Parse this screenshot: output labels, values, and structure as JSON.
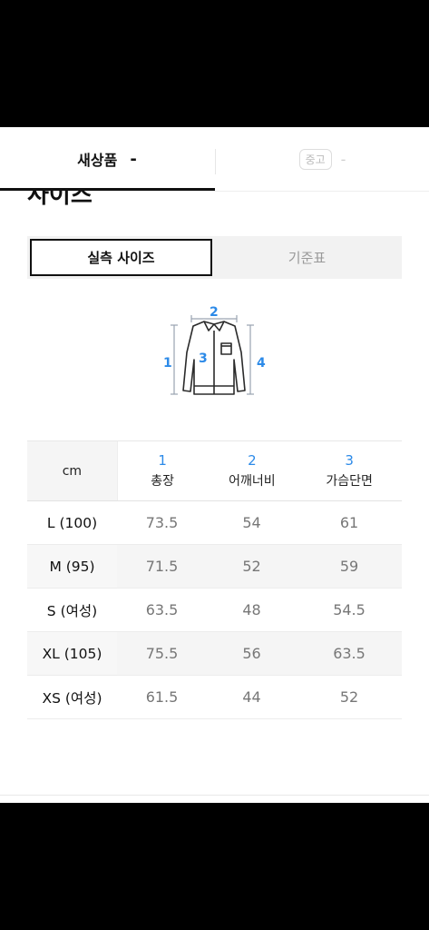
{
  "tabs": {
    "new_label": "새상품",
    "new_price": "-",
    "used_badge": "중고",
    "used_price": "-"
  },
  "section": {
    "title": "사이즈"
  },
  "segmented": {
    "active": "실측 사이즈",
    "inactive": "기준표"
  },
  "diagram": {
    "labels": [
      "1",
      "2",
      "3",
      "4"
    ],
    "accent_color": "#2c8ae8"
  },
  "table": {
    "unit": "cm",
    "columns": [
      {
        "num": "1",
        "label": "총장"
      },
      {
        "num": "2",
        "label": "어깨너비"
      },
      {
        "num": "3",
        "label": "가슴단면"
      }
    ],
    "rows": [
      {
        "size": "L (100)",
        "values": [
          "73.5",
          "54",
          "61"
        ]
      },
      {
        "size": "M (95)",
        "values": [
          "71.5",
          "52",
          "59"
        ]
      },
      {
        "size": "S (여성)",
        "values": [
          "63.5",
          "48",
          "54.5"
        ]
      },
      {
        "size": "XL (105)",
        "values": [
          "75.5",
          "56",
          "63.5"
        ]
      },
      {
        "size": "XS (여성)",
        "values": [
          "61.5",
          "44",
          "52"
        ]
      }
    ]
  }
}
